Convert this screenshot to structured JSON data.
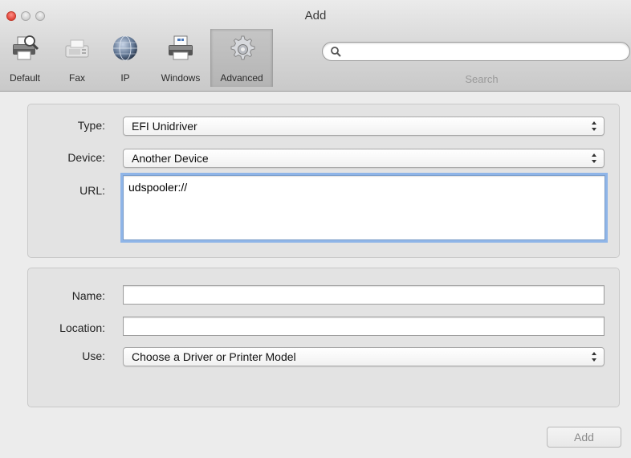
{
  "window": {
    "title": "Add"
  },
  "toolbar": {
    "items": [
      {
        "label": "Default",
        "icon": "default-printer-icon"
      },
      {
        "label": "Fax",
        "icon": "fax-icon"
      },
      {
        "label": "IP",
        "icon": "ip-globe-icon"
      },
      {
        "label": "Windows",
        "icon": "windows-printer-icon"
      },
      {
        "label": "Advanced",
        "icon": "advanced-gear-icon",
        "selected": true
      }
    ],
    "search": {
      "label": "Search",
      "value": "",
      "placeholder": ""
    }
  },
  "connection": {
    "type": {
      "label": "Type:",
      "value": "EFI Unidriver"
    },
    "device": {
      "label": "Device:",
      "value": "Another Device"
    },
    "url": {
      "label": "URL:",
      "value": "udspooler://"
    }
  },
  "details": {
    "name": {
      "label": "Name:",
      "value": ""
    },
    "location": {
      "label": "Location:",
      "value": ""
    },
    "use": {
      "label": "Use:",
      "value": "Choose a Driver or Printer Model"
    }
  },
  "footer": {
    "add_label": "Add"
  },
  "colors": {
    "close": "#e0443a",
    "focus_ring": "#8fb5e8",
    "background": "#ececec"
  }
}
